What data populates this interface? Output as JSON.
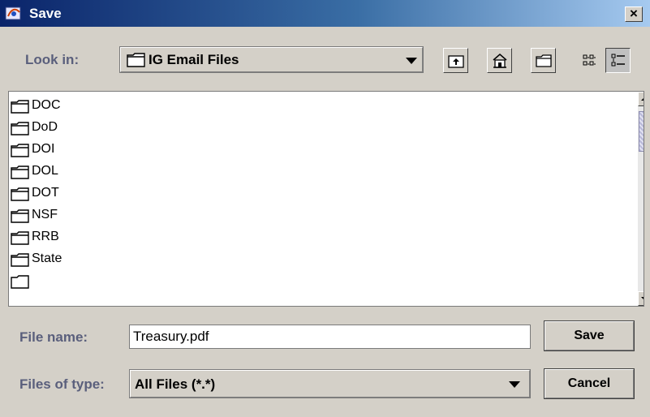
{
  "window": {
    "title": "Save",
    "close_glyph": "×"
  },
  "look_in": {
    "label": "Look in:",
    "value": "IG Email Files"
  },
  "toolbar": {
    "icons": [
      "up-one-level-icon",
      "home-icon",
      "new-folder-icon",
      "list-view-icon",
      "details-view-icon"
    ],
    "selected_view": "details"
  },
  "files": [
    {
      "name": "DOC"
    },
    {
      "name": "DoD"
    },
    {
      "name": "DOI"
    },
    {
      "name": "DOL"
    },
    {
      "name": "DOT"
    },
    {
      "name": "NSF"
    },
    {
      "name": "RRB"
    },
    {
      "name": "State"
    }
  ],
  "file_name": {
    "label": "File name:",
    "value": "Treasury.pdf"
  },
  "files_of_type": {
    "label": "Files of type:",
    "value": "All Files (*.*)"
  },
  "buttons": {
    "save": "Save",
    "cancel": "Cancel"
  },
  "colors": {
    "label_text": "#5a5f7c",
    "title_start": "#0a246a",
    "title_end": "#a6caf0",
    "face": "#d4d0c8"
  }
}
